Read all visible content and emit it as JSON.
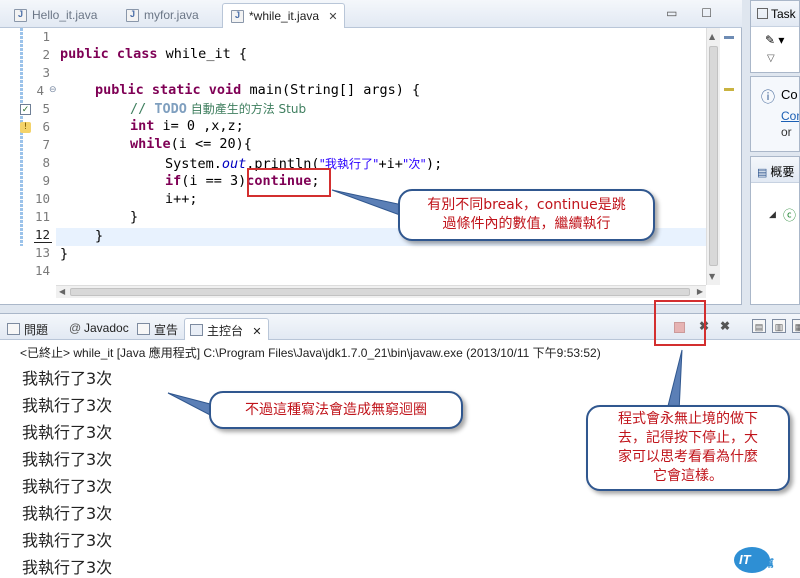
{
  "editor": {
    "tabs": [
      {
        "label": "Hello_it.java"
      },
      {
        "label": "myfor.java"
      },
      {
        "label": "*while_it.java"
      }
    ],
    "active_tab_close": "✕",
    "window_buttons": "▭ ☐",
    "line_numbers": [
      "1",
      "2",
      "3",
      "4",
      "5",
      "6",
      "7",
      "8",
      "9",
      "10",
      "11",
      "12",
      "13",
      "14"
    ],
    "code": {
      "l2_a": "public class",
      "l2_b": " while_it {",
      "l4_a": "public static void",
      "l4_b": " main(String[] args) {",
      "l5_a": "// ",
      "l5_todo": "TODO",
      "l5_b": " 自動產生的方法 Stub",
      "l6_kw": "int",
      "l6_b": " i= 0 ,x,z;",
      "l7_kw": "while",
      "l7_b": "(i <= 20){",
      "l8_a": "System.",
      "l8_fld": "out",
      "l8_b": ".println(",
      "l8_s1": "\"我執行了\"",
      "l8_c": "+i+",
      "l8_s2": "\"次\"",
      "l8_d": ");",
      "l9_kw": "if",
      "l9_b": "(i == 3)",
      "l9_kw2": "continue",
      "l9_c": ";",
      "l10": "i++;",
      "l11": "}",
      "l12": "}",
      "l13": "}"
    }
  },
  "right_panels": {
    "task_title": "Task",
    "connect_title": "Co",
    "connect_link": "Con",
    "connect_or": "or",
    "outline_title": "概要"
  },
  "console": {
    "tabs": [
      {
        "label": "問題"
      },
      {
        "label": "Javadoc"
      },
      {
        "label": "宣告"
      },
      {
        "label": "主控台"
      }
    ],
    "close_glyph": "✕",
    "status": "<已終止> while_it [Java 應用程式] C:\\Program Files\\Java\\jdk1.7.0_21\\bin\\javaw.exe (2013/10/11 下午9:53:52)",
    "output_lines": [
      "我執行了3次",
      "我執行了3次",
      "我執行了3次",
      "我執行了3次",
      "我執行了3次",
      "我執行了3次",
      "我執行了3次",
      "我執行了3次"
    ]
  },
  "annotations": {
    "callout_continue": [
      "有別不同break，continue是跳",
      "過條件內的數值，繼續執行"
    ],
    "callout_loop": "不過這種寫法會造成無窮迴圈",
    "callout_stop": [
      "程式會永無止境的做下",
      "去，記得按下停止，大",
      "家可以思考看看為什麼",
      "它會這樣。"
    ]
  },
  "logo": {
    "text": "IT",
    "suffix": "幫"
  },
  "colors": {
    "keyword": "#7f0055",
    "comment": "#3f7f5f",
    "string": "#2a00ff",
    "annotation_border": "#30578f",
    "annotation_text": "#c0141b",
    "highlight": "#d32f2f"
  }
}
